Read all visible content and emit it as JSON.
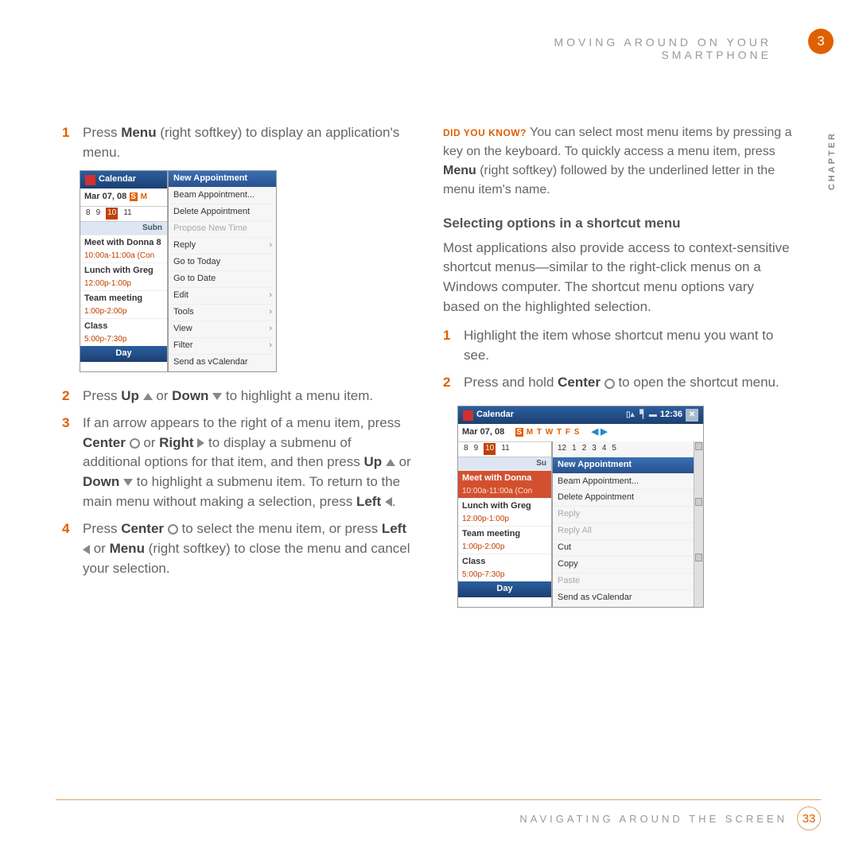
{
  "header": {
    "title": "MOVING AROUND ON YOUR SMARTPHONE",
    "chapter_num": "3",
    "chapter_label": "CHAPTER"
  },
  "footer": {
    "section": "NAVIGATING AROUND THE SCREEN",
    "page": "33"
  },
  "left": {
    "s1a": "Press ",
    "s1b": "Menu",
    "s1c": " (right softkey) to display an application's menu.",
    "s2a": "Press ",
    "s2b": "Up",
    "s2c": " or ",
    "s2d": "Down",
    "s2e": " to highlight a menu item.",
    "s3a": "If an arrow appears to the right of a menu item, press ",
    "s3b": "Center",
    "s3c": " or ",
    "s3d": "Right",
    "s3e": " to display a submenu of additional options for that item, and then press ",
    "s3f": "Up",
    "s3g": " or ",
    "s3h": "Down",
    "s3i": " to highlight a submenu item. To return to the main menu without making a selection, press ",
    "s3j": "Left",
    "s3k": ".",
    "s4a": "Press ",
    "s4b": "Center",
    "s4c": " to select the menu item, or press ",
    "s4d": "Left",
    "s4e": " or ",
    "s4f": "Menu",
    "s4g": " (right softkey) to close the menu and cancel your selection."
  },
  "right": {
    "tip_label": "DID YOU KNOW?",
    "tip_a": " You can select most menu items by pressing a key on the keyboard. To quickly access a menu item, press ",
    "tip_b": "Menu",
    "tip_c": " (right softkey) followed by the underlined letter in the menu item's name.",
    "subhead": "Selecting options in a shortcut menu",
    "para": "Most applications also provide access to context-sensitive shortcut menus—similar to the right-click menus on a Windows computer. The shortcut menu options vary based on the highlighted selection.",
    "r1": "Highlight the item whose shortcut menu you want to see.",
    "r2a": "Press and hold ",
    "r2b": "Center",
    "r2c": " to open the shortcut menu."
  },
  "mock": {
    "app": "Calendar",
    "date": "Mar 07, 08",
    "days_sel": "S",
    "daynums": [
      "8",
      "9",
      "10",
      "11"
    ],
    "daynums2": [
      "12",
      "1",
      "2",
      "3",
      "4",
      "5"
    ],
    "sub": "Subn",
    "su": "Su",
    "e1": "Meet with Donna 8",
    "e1b": "Meet with Donna",
    "e1t": "10:00a-11:00a (Con",
    "e2": "Lunch with Greg",
    "e2t": "12:00p-1:00p",
    "e3": "Team meeting",
    "e3t": "1:00p-2:00p",
    "e4": "Class",
    "e4t": "5:00p-7:30p",
    "foot": "Day",
    "m1": {
      "i0": "New Appointment",
      "i1": "Beam Appointment...",
      "i2": "Delete Appointment",
      "i3": "Propose New Time",
      "i4": "Reply",
      "i5": "Go to Today",
      "i6": "Go to Date",
      "i7": "Edit",
      "i8": "Tools",
      "i9": "View",
      "i10": "Filter",
      "i11": "Send as vCalendar"
    },
    "m2": {
      "i0": "New Appointment",
      "i1": "Beam Appointment...",
      "i2": "Delete Appointment",
      "i3": "Reply",
      "i4": "Reply All",
      "i5": "Cut",
      "i6": "Copy",
      "i7": "Paste",
      "i8": "Send as vCalendar"
    },
    "time": "12:36"
  }
}
